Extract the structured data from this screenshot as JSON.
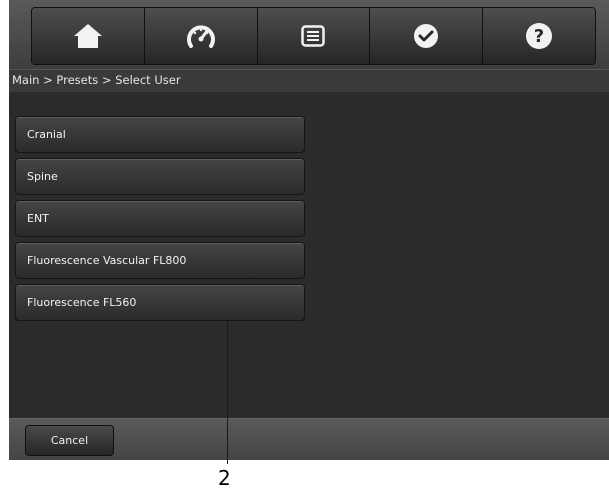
{
  "toolbar": {
    "buttons": [
      {
        "icon": "home-icon"
      },
      {
        "icon": "speedometer-icon"
      },
      {
        "icon": "list-menu-icon"
      },
      {
        "icon": "checkmark-icon"
      },
      {
        "icon": "help-icon"
      }
    ],
    "icon_color": "#f2f2f2"
  },
  "breadcrumb": "Main > Presets > Select User",
  "presets": [
    {
      "label": "Cranial"
    },
    {
      "label": "Spine"
    },
    {
      "label": "ENT"
    },
    {
      "label": "Fluorescence Vascular FL800"
    },
    {
      "label": "Fluorescence FL560"
    }
  ],
  "bottom_bar": {
    "cancel_label": "Cancel"
  },
  "callout": {
    "number": "2"
  }
}
